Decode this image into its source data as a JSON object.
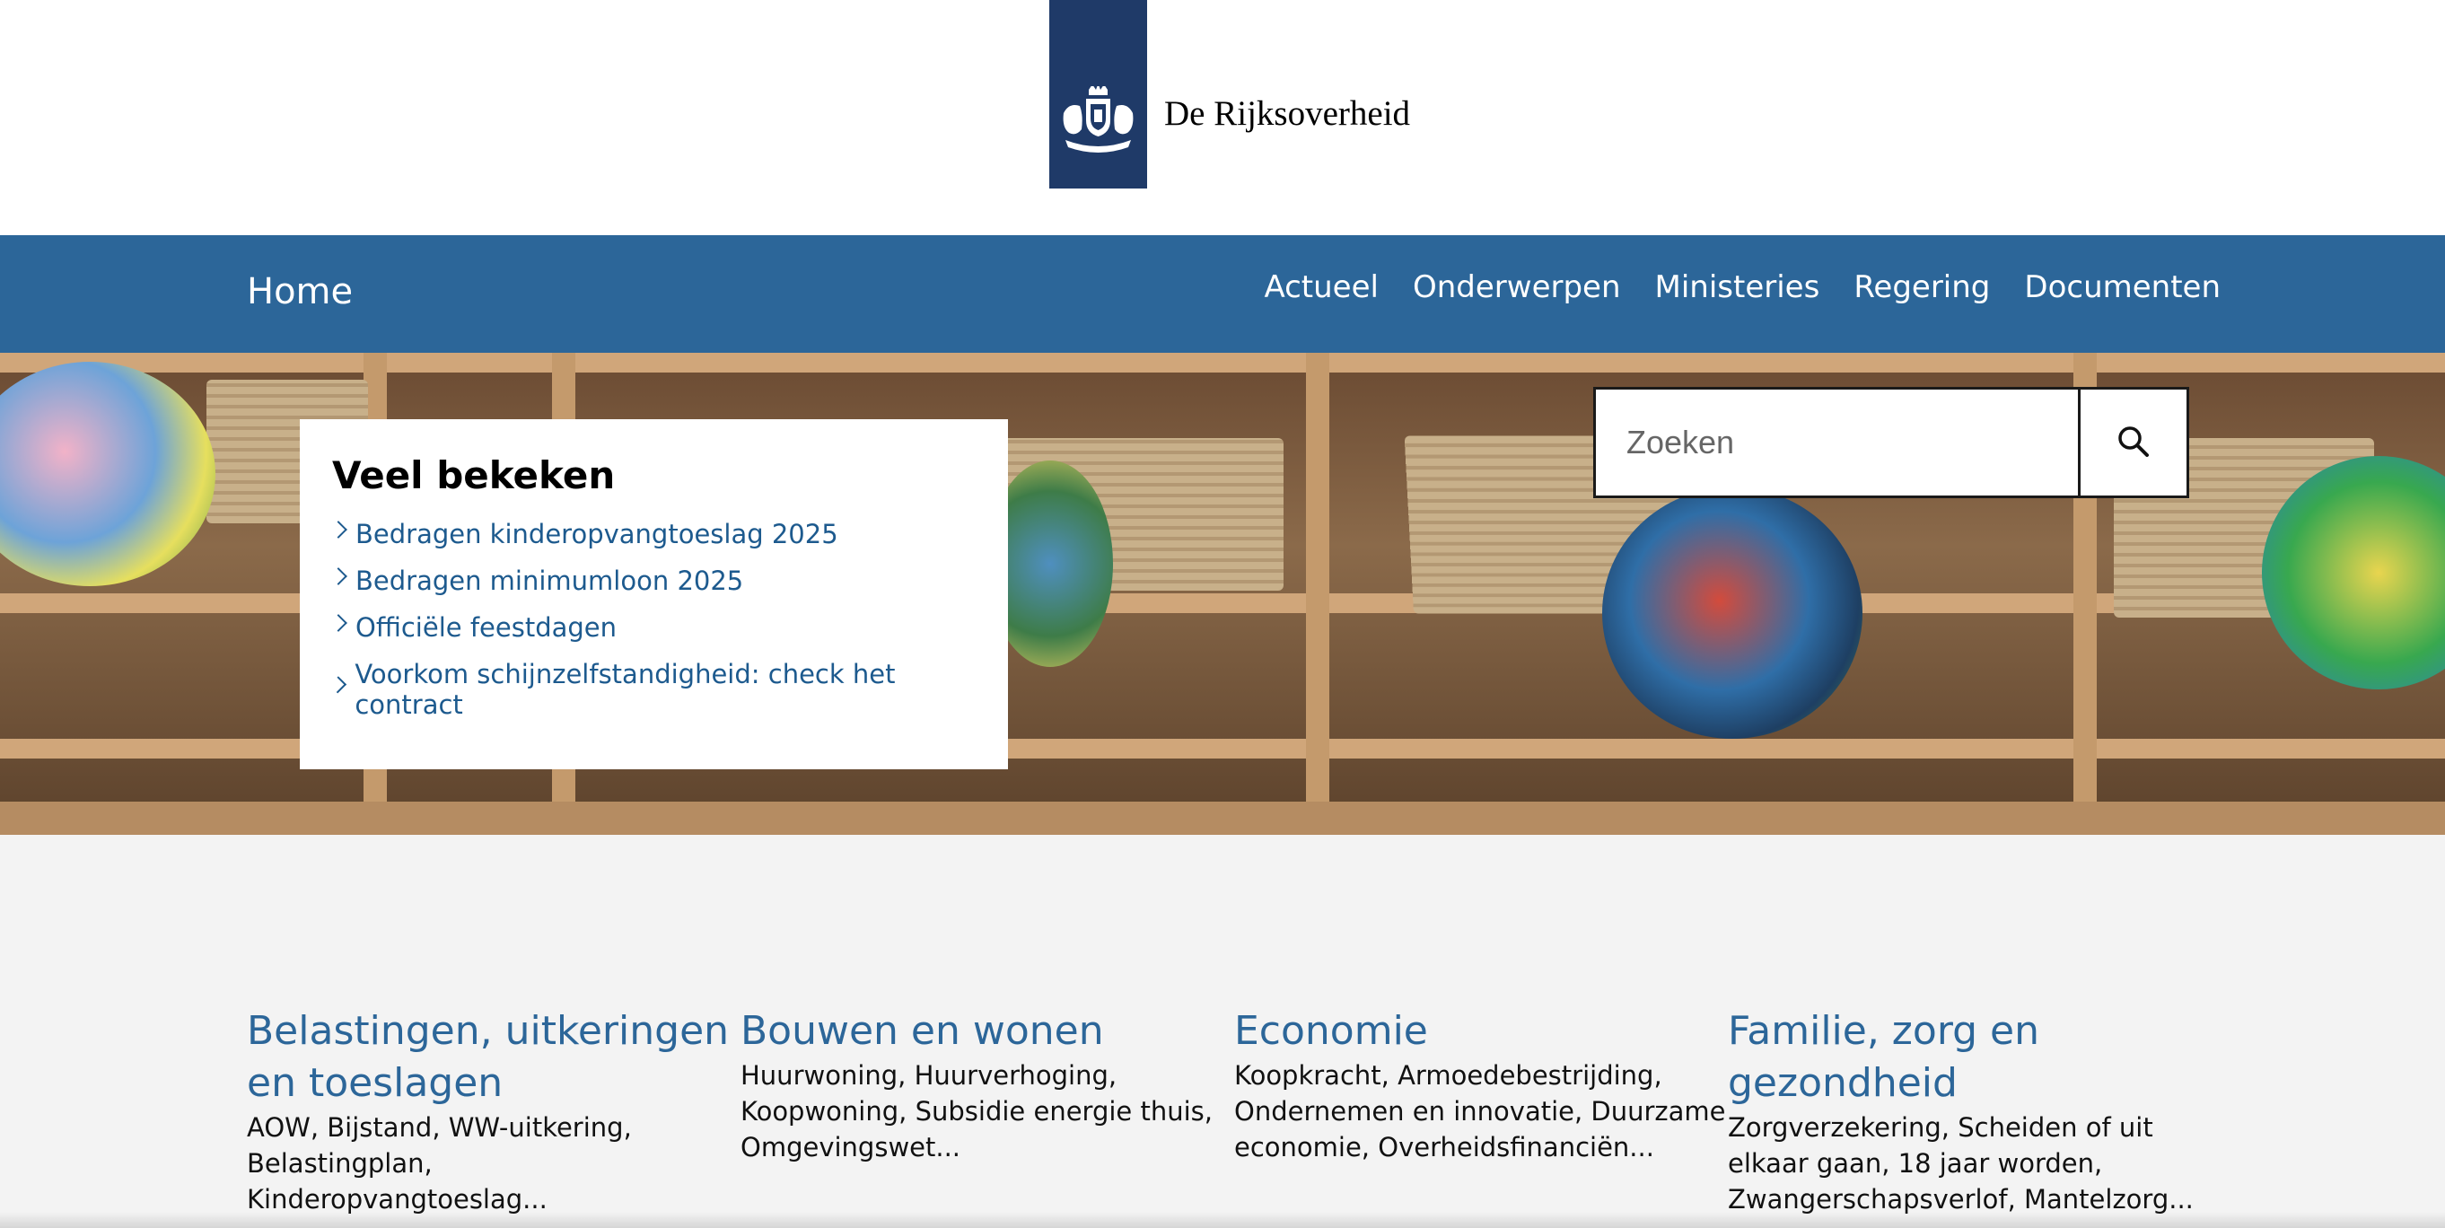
{
  "header": {
    "logo_text": "De Rijksoverheid",
    "logo_icon": "coat-of-arms-icon",
    "brand_color": "#1f3a68"
  },
  "nav": {
    "home": "Home",
    "links": [
      "Actueel",
      "Onderwerpen",
      "Ministeries",
      "Regering",
      "Documenten"
    ],
    "background": "#2c6699"
  },
  "popular": {
    "title": "Veel bekeken",
    "items": [
      "Bedragen kinderopvangtoeslag 2025",
      "Bedragen minimumloon 2025",
      "Officiële feestdagen",
      "Voorkom schijnzelfstandigheid: check het contract"
    ]
  },
  "search": {
    "placeholder": "Zoeken",
    "button_icon": "search-icon"
  },
  "topics": [
    {
      "title": "Belastingen, uitkeringen en toeslagen",
      "desc": "AOW, Bijstand, WW-uitkering, Belastingplan, Kinderopvangtoeslag..."
    },
    {
      "title": "Bouwen en wonen",
      "desc": "Huurwoning, Huurverhoging, Koopwoning, Subsidie energie thuis, Omgevingswet..."
    },
    {
      "title": "Economie",
      "desc": "Koopkracht, Armoedebestrijding, Ondernemen en innovatie, Duurzame economie, Overheidsfinanciën..."
    },
    {
      "title": "Familie, zorg en gezondheid",
      "desc": "Zorgverzekering, Scheiden of uit elkaar gaan, 18 jaar worden, Zwangerschapsverlof, Mantelzorg..."
    }
  ]
}
